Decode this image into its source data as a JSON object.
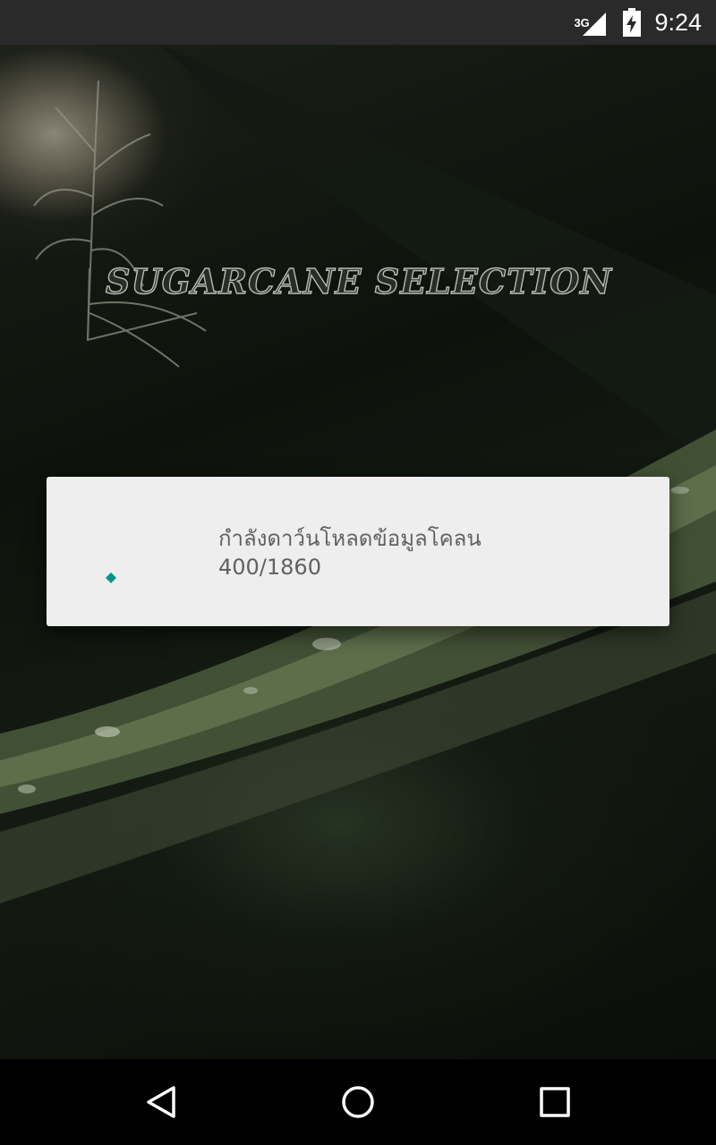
{
  "status_bar": {
    "network": "3G",
    "time": "9:24",
    "icons": [
      "signal-icon",
      "battery-charging-icon"
    ]
  },
  "app": {
    "logo_text": "SUGARCANE SELECTION"
  },
  "dialog": {
    "message_line1": "กำลังดาว์นโหลดข้อมูลโคลน",
    "message_line2": "400/1860",
    "progress": {
      "current": 400,
      "total": 1860
    },
    "accent_color": "#009688"
  },
  "nav_bar": {
    "icons": [
      "back-icon",
      "home-icon",
      "recents-icon"
    ]
  }
}
